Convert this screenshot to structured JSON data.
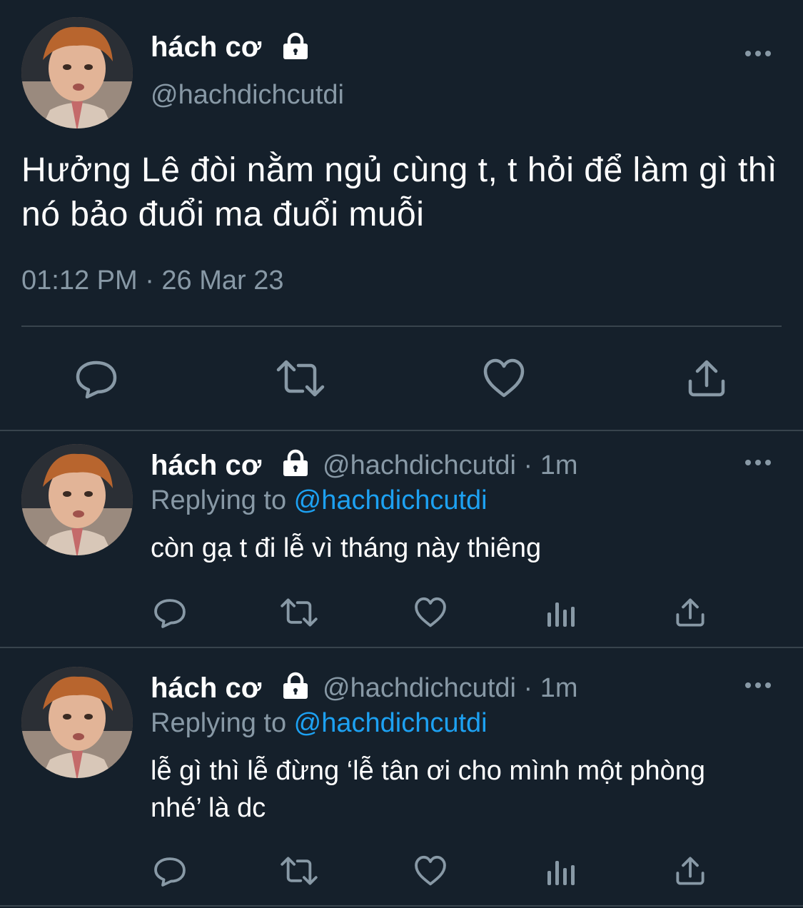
{
  "main_tweet": {
    "display_name": "hách cơ",
    "handle": "@hachdichcutdi",
    "text": "Hưởng Lê đòi nằm ngủ cùng t, t hỏi để làm gì thì nó bảo đuổi ma đuổi muỗi",
    "timestamp": "01:12 PM · 26 Mar 23"
  },
  "replies": [
    {
      "display_name": "hách cơ",
      "handle_time": "@hachdichcutdi · 1m",
      "replying_prefix": "Replying to ",
      "replying_handle": "@hachdichcutdi",
      "text": "còn gạ t đi lễ vì tháng này thiêng"
    },
    {
      "display_name": "hách cơ",
      "handle_time": "@hachdichcutdi · 1m",
      "replying_prefix": "Replying to ",
      "replying_handle": "@hachdichcutdi",
      "text": "lễ gì thì lễ đừng ‘lễ tân ơi cho mình một phòng nhé’ là dc"
    }
  ],
  "icons": {
    "reply": "reply-icon",
    "retweet": "retweet-icon",
    "like": "heart-icon",
    "share": "share-icon",
    "analytics": "analytics-icon",
    "lock": "lock-icon",
    "more": "more-icon"
  },
  "colors": {
    "background": "#15202b",
    "secondary_text": "#8899a6",
    "link": "#1da1f2",
    "divider": "#38444d"
  }
}
